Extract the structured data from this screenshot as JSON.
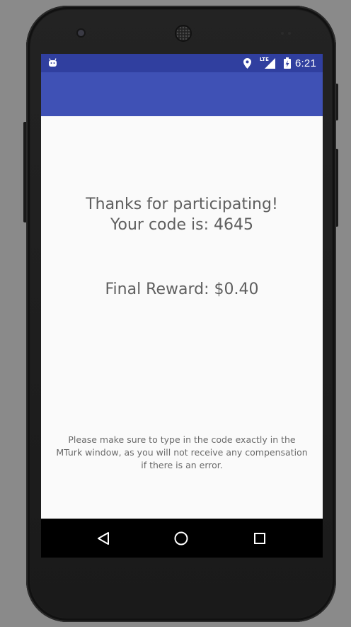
{
  "status_bar": {
    "time": "6:21",
    "network_label": "LTE",
    "icons": [
      "android-notification-icon",
      "location-pin-icon",
      "lte-signal-icon",
      "battery-charging-icon"
    ]
  },
  "colors": {
    "status_bar": "#303f9f",
    "app_bar": "#3f51b5",
    "background": "#fafafa",
    "text": "#5f5f5f",
    "nav_bar": "#000000"
  },
  "main": {
    "thanks_line": "Thanks for participating!",
    "code_line": "Your code is: 4645",
    "reward_line": "Final Reward: $0.40",
    "note_lines": [
      "Please make sure to type in the code exactly in the",
      "MTurk window, as you will not receive any compensation",
      "if there is an error."
    ]
  },
  "nav_bar": {
    "icons": [
      "back-triangle-icon",
      "home-circle-icon",
      "recents-square-icon"
    ]
  }
}
